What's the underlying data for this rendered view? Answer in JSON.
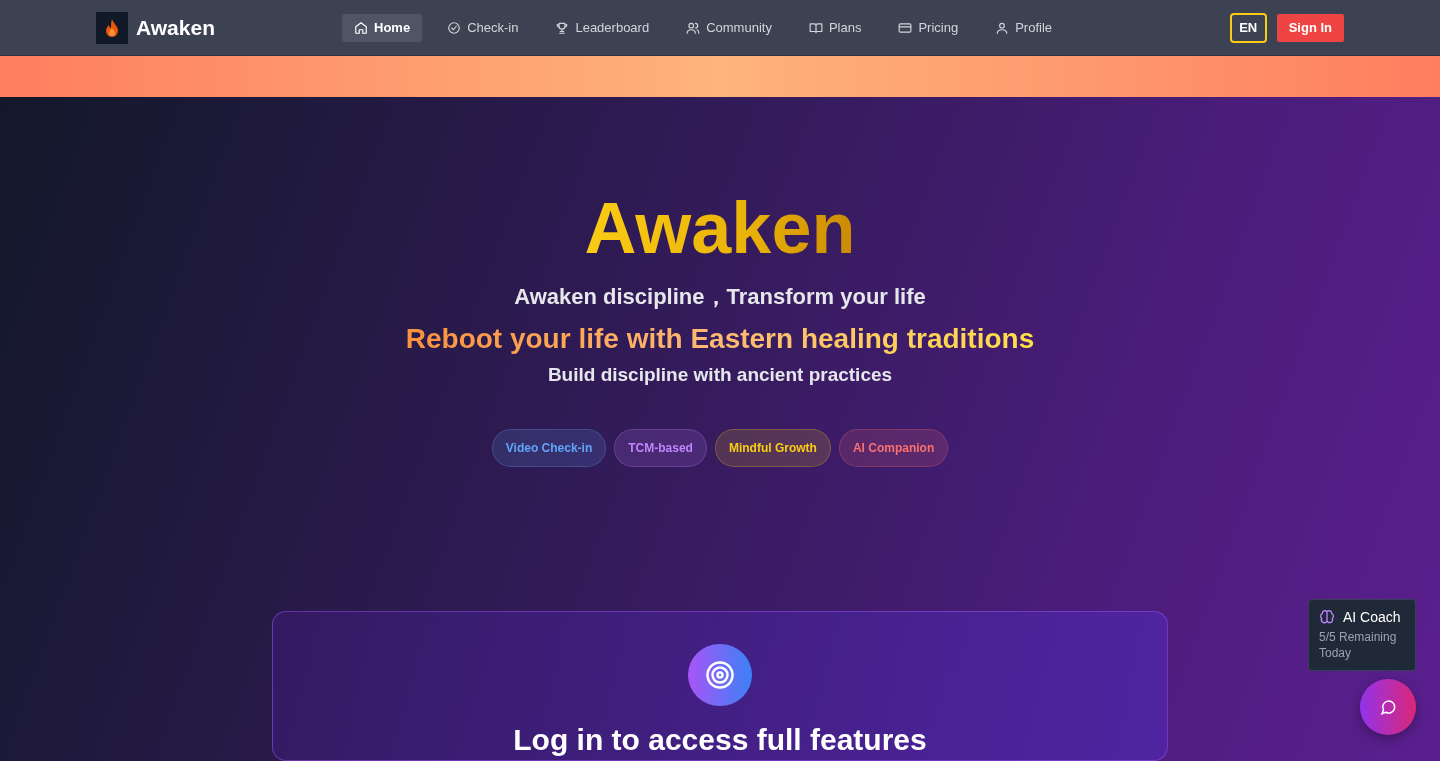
{
  "nav": {
    "brand": "Awaken",
    "items": [
      {
        "label": "Home",
        "selected": true
      },
      {
        "label": "Check-in",
        "selected": false
      },
      {
        "label": "Leaderboard",
        "selected": false
      },
      {
        "label": "Community",
        "selected": false
      },
      {
        "label": "Plans",
        "selected": false
      },
      {
        "label": "Pricing",
        "selected": false
      },
      {
        "label": "Profile",
        "selected": false
      }
    ],
    "language": "EN",
    "sign_in": "Sign In"
  },
  "hero": {
    "title": "Awaken",
    "subtitle": "Awaken discipline，Transform your life",
    "tagline": "Reboot your life with Eastern healing traditions",
    "motto": "Build discipline with ancient practices",
    "tags": [
      {
        "label": "Video Check-in",
        "color": "#60a5fa"
      },
      {
        "label": "TCM-based",
        "color": "#c084fc"
      },
      {
        "label": "Mindful Growth",
        "color": "#facc15"
      },
      {
        "label": "AI Companion",
        "color": "#f87171"
      }
    ]
  },
  "login_card": {
    "heading": "Log in to access full features"
  },
  "ai_coach": {
    "title": "AI Coach",
    "remaining": "5/5 Remaining Today"
  }
}
